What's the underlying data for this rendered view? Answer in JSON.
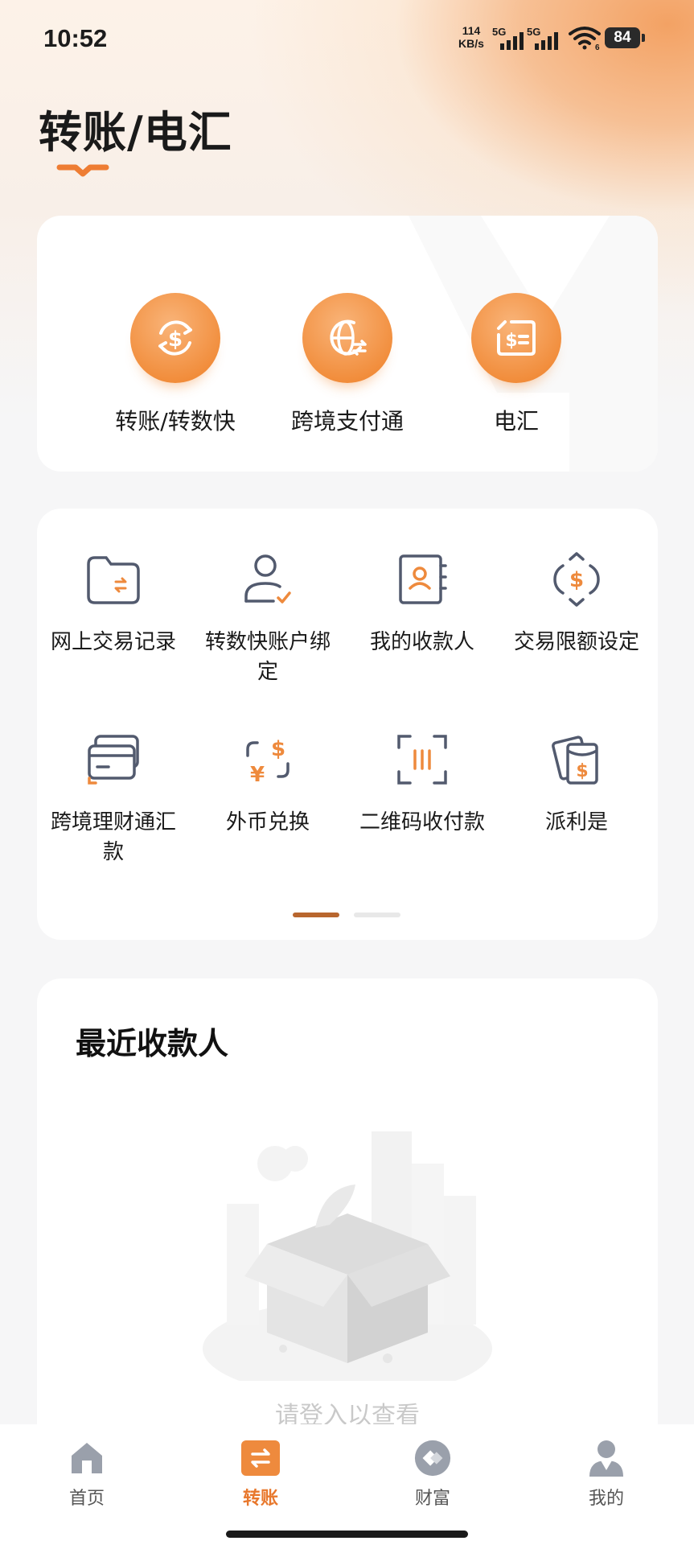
{
  "status_bar": {
    "time": "10:52",
    "net_speed_value": "114",
    "net_speed_unit": "KB/s",
    "sim1_label": "5G",
    "sim2_label": "5G",
    "wifi_badge": "6",
    "battery": "84"
  },
  "header": {
    "title": "转账/电汇"
  },
  "primary_actions": [
    {
      "label": "转账/转数快",
      "icon": "dollar-exchange-icon"
    },
    {
      "label": "跨境支付通",
      "icon": "globe-transfer-icon"
    },
    {
      "label": "电汇",
      "icon": "wire-receipt-icon"
    }
  ],
  "services": [
    {
      "label": "网上交易记录",
      "icon": "folder-transfer-icon"
    },
    {
      "label": "转数快账户绑定",
      "icon": "user-check-icon"
    },
    {
      "label": "我的收款人",
      "icon": "contact-book-icon"
    },
    {
      "label": "交易限额设定",
      "icon": "limit-dollar-icon"
    },
    {
      "label": "跨境理财通汇款",
      "icon": "cards-icon"
    },
    {
      "label": "外币兑换",
      "icon": "currency-exchange-icon"
    },
    {
      "label": "二维码收付款",
      "icon": "qr-scan-icon"
    },
    {
      "label": "派利是",
      "icon": "red-packet-icon"
    }
  ],
  "pager": {
    "current": 1,
    "total": 2
  },
  "recent_payees": {
    "title": "最近收款人",
    "empty_text": "请登入以查看"
  },
  "tabs": [
    {
      "label": "首页",
      "icon": "home-icon",
      "active": false
    },
    {
      "label": "转账",
      "icon": "transfer-icon",
      "active": true
    },
    {
      "label": "财富",
      "icon": "wealth-icon",
      "active": false
    },
    {
      "label": "我的",
      "icon": "profile-icon",
      "active": false
    }
  ],
  "colors": {
    "accent": "#f18c3a",
    "active_tab": "#e8782d",
    "pager_active": "#b8662e"
  }
}
